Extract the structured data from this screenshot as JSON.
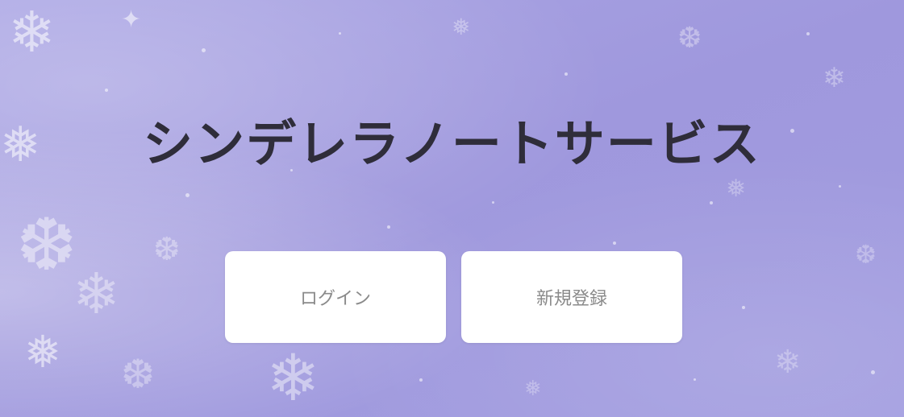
{
  "page": {
    "title": "シンデレラノートサービス"
  },
  "buttons": {
    "login_label": "ログイン",
    "register_label": "新規登録"
  },
  "theme": {
    "background": "#a39ddf",
    "title_color": "#2f2d3a",
    "button_bg": "#ffffff",
    "button_text": "#8a8a8a"
  },
  "decorations": {
    "snowflake_icon": "snowflake-icon"
  }
}
